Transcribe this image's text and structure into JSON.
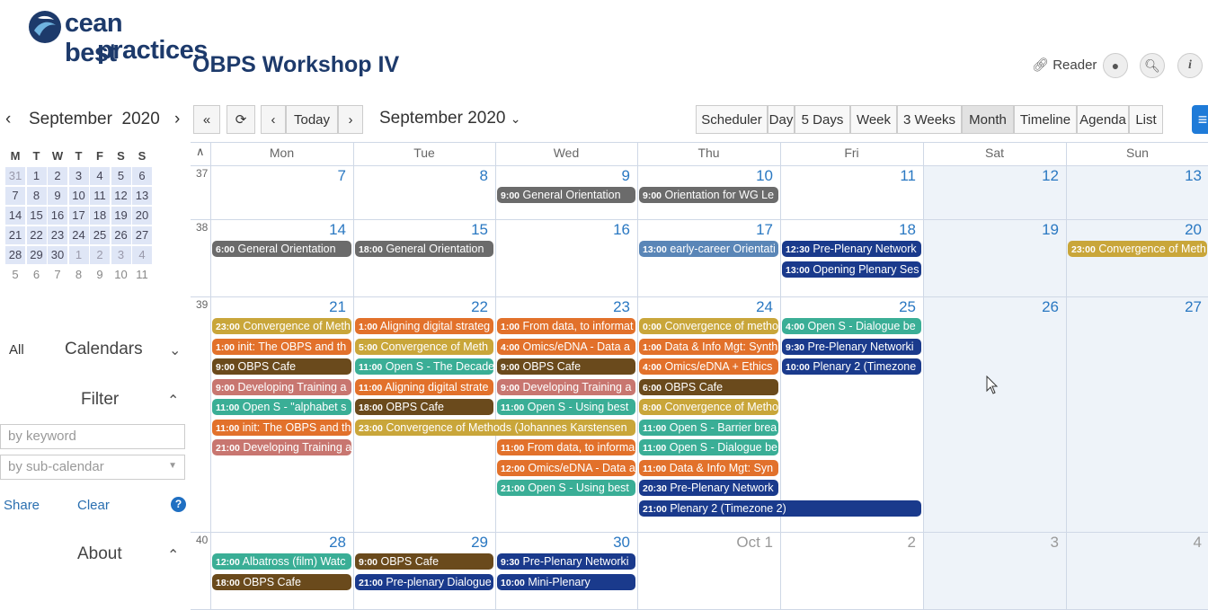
{
  "header": {
    "logo_line1": "cean best",
    "logo_line2": "practices",
    "page_title": "OBPS Workshop IV",
    "reader_label": "Reader"
  },
  "mini_calendar": {
    "title": "September  2020",
    "weekdays": [
      "M",
      "T",
      "W",
      "T",
      "F",
      "S",
      "S"
    ],
    "weeks": [
      [
        "31",
        "1",
        "2",
        "3",
        "4",
        "5",
        "6"
      ],
      [
        "7",
        "8",
        "9",
        "10",
        "11",
        "12",
        "13"
      ],
      [
        "14",
        "15",
        "16",
        "17",
        "18",
        "19",
        "20"
      ],
      [
        "21",
        "22",
        "23",
        "24",
        "25",
        "26",
        "27"
      ],
      [
        "28",
        "29",
        "30",
        "1",
        "2",
        "3",
        "4"
      ],
      [
        "5",
        "6",
        "7",
        "8",
        "9",
        "10",
        "11"
      ]
    ]
  },
  "sidebar": {
    "all_label": "All",
    "calendars_label": "Calendars",
    "filter_label": "Filter",
    "keyword_placeholder": "by keyword",
    "subcal_placeholder": "by sub-calendar",
    "share_label": "Share",
    "clear_label": "Clear",
    "about_label": "About"
  },
  "toolbar": {
    "today_label": "Today",
    "period_label": "September 2020",
    "views": [
      "Scheduler",
      "Day",
      "5 Days",
      "Week",
      "3 Weeks",
      "Month",
      "Timeline",
      "Agenda",
      "List"
    ],
    "active_view": "Month"
  },
  "grid": {
    "weekdays": [
      "Mon",
      "Tue",
      "Wed",
      "Thu",
      "Fri",
      "Sat",
      "Sun"
    ],
    "weeks": [
      {
        "num": "37",
        "days": [
          "7",
          "8",
          "9",
          "10",
          "11",
          "12",
          "13"
        ]
      },
      {
        "num": "38",
        "days": [
          "14",
          "15",
          "16",
          "17",
          "18",
          "19",
          "20"
        ]
      },
      {
        "num": "39",
        "days": [
          "21",
          "22",
          "23",
          "24",
          "25",
          "26",
          "27"
        ]
      },
      {
        "num": "40",
        "days": [
          "28",
          "29",
          "30",
          "Oct 1",
          "2",
          "3",
          "4"
        ]
      }
    ]
  },
  "colors": {
    "gray": "#6b6b6b",
    "steel": "#5a86b7",
    "navy": "#1a3a8c",
    "gold": "#c9a63a",
    "orange": "#e2712b",
    "brown": "#6a4a1c",
    "rose": "#c87670",
    "teal": "#3aae96"
  },
  "events": [
    {
      "t": "9:00",
      "n": "General Orientation",
      "w": 0,
      "d": 2,
      "row": 0,
      "span": 1,
      "c": "gray"
    },
    {
      "t": "9:00",
      "n": "Orientation for WG Le",
      "w": 0,
      "d": 3,
      "row": 0,
      "span": 1,
      "c": "gray"
    },
    {
      "t": "6:00",
      "n": "General Orientation",
      "w": 1,
      "d": 0,
      "row": 0,
      "span": 1,
      "c": "gray"
    },
    {
      "t": "18:00",
      "n": "General Orientation",
      "w": 1,
      "d": 1,
      "row": 0,
      "span": 1,
      "c": "gray"
    },
    {
      "t": "13:00",
      "n": "early-career Orientati",
      "w": 1,
      "d": 3,
      "row": 0,
      "span": 1,
      "c": "steel"
    },
    {
      "t": "12:30",
      "n": "Pre-Plenary Network",
      "w": 1,
      "d": 4,
      "row": 0,
      "span": 1,
      "c": "navy"
    },
    {
      "t": "13:00",
      "n": "Opening Plenary Ses",
      "w": 1,
      "d": 4,
      "row": 1,
      "span": 1,
      "c": "navy"
    },
    {
      "t": "23:00",
      "n": "Convergence of Meth",
      "w": 1,
      "d": 6,
      "row": 0,
      "span": 1,
      "c": "gold"
    },
    {
      "t": "23:00",
      "n": "Convergence of Meth",
      "w": 2,
      "d": 0,
      "row": 0,
      "span": 1,
      "c": "gold"
    },
    {
      "t": "1:00",
      "n": "init: The OBPS and th",
      "w": 2,
      "d": 0,
      "row": 1,
      "span": 1,
      "c": "orange"
    },
    {
      "t": "9:00",
      "n": "OBPS Cafe",
      "w": 2,
      "d": 0,
      "row": 2,
      "span": 1,
      "c": "brown"
    },
    {
      "t": "9:00",
      "n": "Developing Training a",
      "w": 2,
      "d": 0,
      "row": 3,
      "span": 1,
      "c": "rose"
    },
    {
      "t": "11:00",
      "n": "Open S - \"alphabet s",
      "w": 2,
      "d": 0,
      "row": 4,
      "span": 1,
      "c": "teal"
    },
    {
      "t": "11:00",
      "n": "init: The OBPS and th",
      "w": 2,
      "d": 0,
      "row": 5,
      "span": 1,
      "c": "orange"
    },
    {
      "t": "21:00",
      "n": "Developing Training a",
      "w": 2,
      "d": 0,
      "row": 6,
      "span": 1,
      "c": "rose"
    },
    {
      "t": "1:00",
      "n": "Aligning digital strateg",
      "w": 2,
      "d": 1,
      "row": 0,
      "span": 1,
      "c": "orange"
    },
    {
      "t": "5:00",
      "n": "Convergence of Meth",
      "w": 2,
      "d": 1,
      "row": 1,
      "span": 1,
      "c": "gold"
    },
    {
      "t": "11:00",
      "n": "Open S - The Decade",
      "w": 2,
      "d": 1,
      "row": 2,
      "span": 1,
      "c": "teal"
    },
    {
      "t": "11:00",
      "n": "Aligning digital strate",
      "w": 2,
      "d": 1,
      "row": 3,
      "span": 1,
      "c": "orange"
    },
    {
      "t": "18:00",
      "n": "OBPS Cafe",
      "w": 2,
      "d": 1,
      "row": 4,
      "span": 1,
      "c": "brown"
    },
    {
      "t": "23:00",
      "n": "Convergence of Methods (Johannes Karstensen",
      "w": 2,
      "d": 1,
      "row": 5,
      "span": 2,
      "c": "gold"
    },
    {
      "t": "1:00",
      "n": "From data, to informat",
      "w": 2,
      "d": 2,
      "row": 0,
      "span": 1,
      "c": "orange"
    },
    {
      "t": "4:00",
      "n": "Omics/eDNA - Data a",
      "w": 2,
      "d": 2,
      "row": 1,
      "span": 1,
      "c": "orange"
    },
    {
      "t": "9:00",
      "n": "OBPS Cafe",
      "w": 2,
      "d": 2,
      "row": 2,
      "span": 1,
      "c": "brown"
    },
    {
      "t": "9:00",
      "n": "Developing Training a",
      "w": 2,
      "d": 2,
      "row": 3,
      "span": 1,
      "c": "rose"
    },
    {
      "t": "11:00",
      "n": "Open S - Using best",
      "w": 2,
      "d": 2,
      "row": 4,
      "span": 1,
      "c": "teal"
    },
    {
      "t": "11:00",
      "n": "From data, to informa",
      "w": 2,
      "d": 2,
      "row": 6,
      "span": 1,
      "c": "orange"
    },
    {
      "t": "12:00",
      "n": "Omics/eDNA - Data a",
      "w": 2,
      "d": 2,
      "row": 7,
      "span": 1,
      "c": "orange"
    },
    {
      "t": "21:00",
      "n": "Open S - Using best",
      "w": 2,
      "d": 2,
      "row": 8,
      "span": 1,
      "c": "teal"
    },
    {
      "t": "0:00",
      "n": "Convergence of metho",
      "w": 2,
      "d": 3,
      "row": 0,
      "span": 1,
      "c": "gold"
    },
    {
      "t": "1:00",
      "n": "Data & Info Mgt: Synth",
      "w": 2,
      "d": 3,
      "row": 1,
      "span": 1,
      "c": "orange"
    },
    {
      "t": "4:00",
      "n": "Omics/eDNA + Ethics",
      "w": 2,
      "d": 3,
      "row": 2,
      "span": 1,
      "c": "orange"
    },
    {
      "t": "6:00",
      "n": "OBPS Cafe",
      "w": 2,
      "d": 3,
      "row": 3,
      "span": 1,
      "c": "brown"
    },
    {
      "t": "8:00",
      "n": "Convergence of Metho",
      "w": 2,
      "d": 3,
      "row": 4,
      "span": 1,
      "c": "gold"
    },
    {
      "t": "11:00",
      "n": "Open S - Barrier brea",
      "w": 2,
      "d": 3,
      "row": 5,
      "span": 1,
      "c": "teal"
    },
    {
      "t": "11:00",
      "n": "Open S - Dialogue be",
      "w": 2,
      "d": 3,
      "row": 6,
      "span": 1,
      "c": "teal"
    },
    {
      "t": "11:00",
      "n": "Data & Info Mgt: Syn",
      "w": 2,
      "d": 3,
      "row": 7,
      "span": 1,
      "c": "orange"
    },
    {
      "t": "20:30",
      "n": "Pre-Plenary Network",
      "w": 2,
      "d": 3,
      "row": 8,
      "span": 1,
      "c": "navy"
    },
    {
      "t": "21:00",
      "n": "Plenary 2 (Timezone 2)",
      "w": 2,
      "d": 3,
      "row": 9,
      "span": 2,
      "c": "navy"
    },
    {
      "t": "4:00",
      "n": "Open S - Dialogue be",
      "w": 2,
      "d": 4,
      "row": 0,
      "span": 1,
      "c": "teal"
    },
    {
      "t": "9:30",
      "n": "Pre-Plenary Networki",
      "w": 2,
      "d": 4,
      "row": 1,
      "span": 1,
      "c": "navy"
    },
    {
      "t": "10:00",
      "n": "Plenary 2 (Timezone",
      "w": 2,
      "d": 4,
      "row": 2,
      "span": 1,
      "c": "navy"
    },
    {
      "t": "12:00",
      "n": "Albatross (film) Watc",
      "w": 3,
      "d": 0,
      "row": 0,
      "span": 1,
      "c": "teal"
    },
    {
      "t": "18:00",
      "n": "OBPS Cafe",
      "w": 3,
      "d": 0,
      "row": 1,
      "span": 1,
      "c": "brown"
    },
    {
      "t": "9:00",
      "n": "OBPS Cafe",
      "w": 3,
      "d": 1,
      "row": 0,
      "span": 1,
      "c": "brown"
    },
    {
      "t": "21:00",
      "n": "Pre-plenary Dialogue",
      "w": 3,
      "d": 1,
      "row": 1,
      "span": 1,
      "c": "navy"
    },
    {
      "t": "9:30",
      "n": "Pre-Plenary Networki",
      "w": 3,
      "d": 2,
      "row": 0,
      "span": 1,
      "c": "navy"
    },
    {
      "t": "10:00",
      "n": "Mini-Plenary",
      "w": 3,
      "d": 2,
      "row": 1,
      "span": 1,
      "c": "navy"
    }
  ]
}
